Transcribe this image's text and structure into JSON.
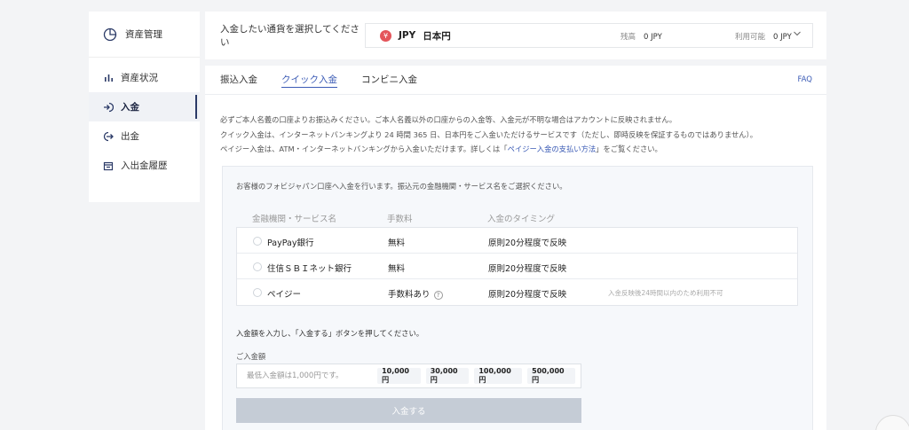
{
  "sidebar": {
    "title": "資産管理",
    "items": [
      {
        "label": "資産状況"
      },
      {
        "label": "入金"
      },
      {
        "label": "出金"
      },
      {
        "label": "入出金履歴"
      }
    ]
  },
  "currency": {
    "prompt": "入金したい通貨を選択してください",
    "symbol": "¥",
    "code": "JPY",
    "name": "日本円",
    "balance_label": "残高",
    "balance_value": "0 JPY",
    "available_label": "利用可能",
    "available_value": "0 JPY"
  },
  "tabs": [
    {
      "label": "振込入金"
    },
    {
      "label": "クイック入金"
    },
    {
      "label": "コンビニ入金"
    }
  ],
  "faq": "FAQ",
  "notes": {
    "line1": "必ずご本人名義の口座よりお振込みください。ご本人名義以外の口座からの入金等、入金元が不明な場合はアカウントに反映されません。",
    "line2": "クイック入金は、インターネットバンキングより 24 時間 365 日、日本円をご入金いただけるサービスです（ただし、即時反映を保証するものではありません）。",
    "line3_pre": "ペイジー入金は、ATM・インターネットバンキングから入金いただけます。詳しくは「",
    "line3_link": "ペイジー入金の支払い方法",
    "line3_post": "」をご覧ください。"
  },
  "box": {
    "intro": "お客様のフォビジャパン口座へ入金を行います。振込元の金融機関・サービス名をご選択ください。",
    "headers": {
      "name": "金融機関・サービス名",
      "fee": "手数料",
      "timing": "入金のタイミング"
    },
    "rows": [
      {
        "name": "PayPay銀行",
        "fee": "無料",
        "timing": "原則20分程度で反映",
        "note": ""
      },
      {
        "name": "住信ＳＢＩネット銀行",
        "fee": "無料",
        "timing": "原則20分程度で反映",
        "note": ""
      },
      {
        "name": "ペイジー",
        "fee": "手数料あり",
        "timing": "原則20分程度で反映",
        "note": "入金反映後24時間以内のため利用不可"
      }
    ],
    "amount_intro": "入金額を入力し、「入金する」ボタンを押してください。",
    "amount_label": "ご入金額",
    "amount_placeholder": "最低入金額は1,000円です。",
    "presets": [
      "10,000 円",
      "30,000 円",
      "100,000 円",
      "500,000 円"
    ],
    "submit_label": "入金する"
  }
}
